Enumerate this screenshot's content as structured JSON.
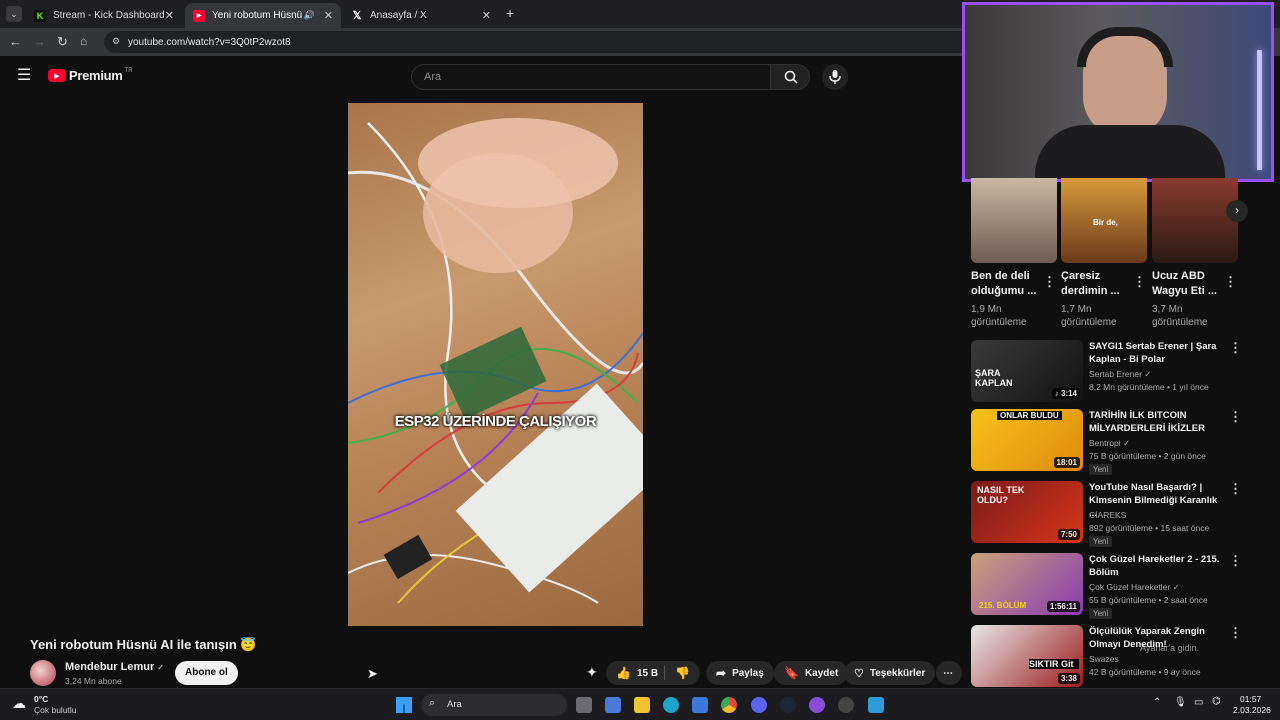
{
  "browser": {
    "tabs": [
      {
        "label": "Stream - Kick Dashboard",
        "active": false
      },
      {
        "label": "Yeni robotum Hüsnü AI ile t",
        "active": true
      },
      {
        "label": "Anasayfa / X",
        "active": false
      }
    ],
    "url": "youtube.com/watch?v=3Q0tP2wzot8"
  },
  "youtube": {
    "logo": "Premium",
    "region": "TR",
    "search_placeholder": "Ara"
  },
  "video": {
    "overlay_text": "ESP32 ÜZERİNDE ÇALIŞIYOR",
    "title": "Yeni robotum Hüsnü AI ile tanışın 😇",
    "channel": "Mendebur Lemur",
    "subscribers": "3,24 Mn abone",
    "subscribe_label": "Abone ol",
    "likes": "15 B",
    "share_label": "Paylaş",
    "save_label": "Kaydet",
    "thanks_label": "Teşekkürler"
  },
  "shorts": [
    {
      "title": "Ben de deli olduğumu ...",
      "views": "1,9 Mn görüntüleme",
      "thumb_text": ""
    },
    {
      "title": "Çaresiz derdimin ...",
      "views": "1,7 Mn görüntüleme",
      "thumb_text": "Bir de,"
    },
    {
      "title": "Ucuz ABD Wagyu Eti ...",
      "views": "3,7 Mn görüntüleme",
      "thumb_text": ""
    }
  ],
  "related": [
    {
      "title": "SAYGI1 Sertab Erener | Şara Kaplan - Bi Polar",
      "channel": "Sertab Erener",
      "meta": "8,2 Mn görüntüleme • 1 yıl önce",
      "duration": "♪ 3:14",
      "new": "",
      "thumb_text": "ŞARA KAPLAN"
    },
    {
      "title": "TARİHİN İLK BITCOIN MİLYARDERLERİ İKİZLER",
      "channel": "Bentropi",
      "meta": "75 B görüntüleme • 2 gün önce",
      "duration": "18:01",
      "new": "Yeni",
      "thumb_text": "ONLAR BULDU"
    },
    {
      "title": "YouTube Nasıl Başardı? | Kimsenin Bilmediği Karanlık ...",
      "channel": "CİAREKS",
      "meta": "892 görüntüleme • 15 saat önce",
      "duration": "7:50",
      "new": "Yeni",
      "thumb_text": "NASIL TEK OLDU?"
    },
    {
      "title": "Çok Güzel Hareketler 2 - 215. Bölüm",
      "channel": "Çok Güzel Hareketler",
      "meta": "55 B görüntüleme • 2 saat önce",
      "duration": "1:56:11",
      "new": "Yeni",
      "thumb_text": "215. BÖLÜM"
    },
    {
      "title": "Ölçülülük Yaparak Zengin Olmayı Denedim!",
      "channel": "Swazes",
      "meta": "42 B görüntüleme • 9 ay önce",
      "duration": "3:38",
      "new": "",
      "thumb_text": "SIKTIR Git"
    }
  ],
  "windows_overlay": "Ayarlar'a gidin.",
  "taskbar": {
    "weather_temp": "0°C",
    "weather_desc": "Çok bulutlu",
    "search_label": "Ara",
    "time": "01:57",
    "date": "2.03.2026"
  },
  "colors": {
    "accent_red": "#ff0033",
    "webcam_border": "#9b4dff"
  }
}
